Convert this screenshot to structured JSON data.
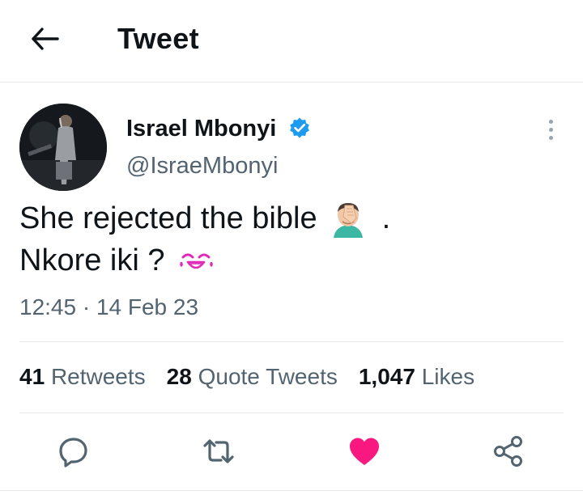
{
  "header": {
    "title": "Tweet",
    "back_icon": "arrow-left-icon"
  },
  "tweet": {
    "author": {
      "name": "Israel Mbonyi",
      "handle": "@IsraeMbonyi",
      "verified": true
    },
    "text_line1": "She rejected the bible",
    "text_line1_suffix": ".",
    "text_line2": "Nkore iki ?",
    "emojis": [
      "man-facepalming-emoji",
      "laughing-emoji"
    ],
    "timestamp": "12:45 · 14 Feb 23"
  },
  "stats": {
    "retweets": {
      "count": "41",
      "label": "Retweets"
    },
    "quotes": {
      "count": "28",
      "label": "Quote Tweets"
    },
    "likes": {
      "count": "1,047",
      "label": "Likes"
    }
  },
  "actions": {
    "reply_icon": "reply-icon",
    "retweet_icon": "retweet-icon",
    "like_icon": "heart-icon",
    "share_icon": "share-icon",
    "like_color": "#f91880",
    "icon_color": "#536471"
  },
  "colors": {
    "verified": "#1d9bf0",
    "secondary_text": "#536471",
    "divider": "#e6e9ec"
  }
}
